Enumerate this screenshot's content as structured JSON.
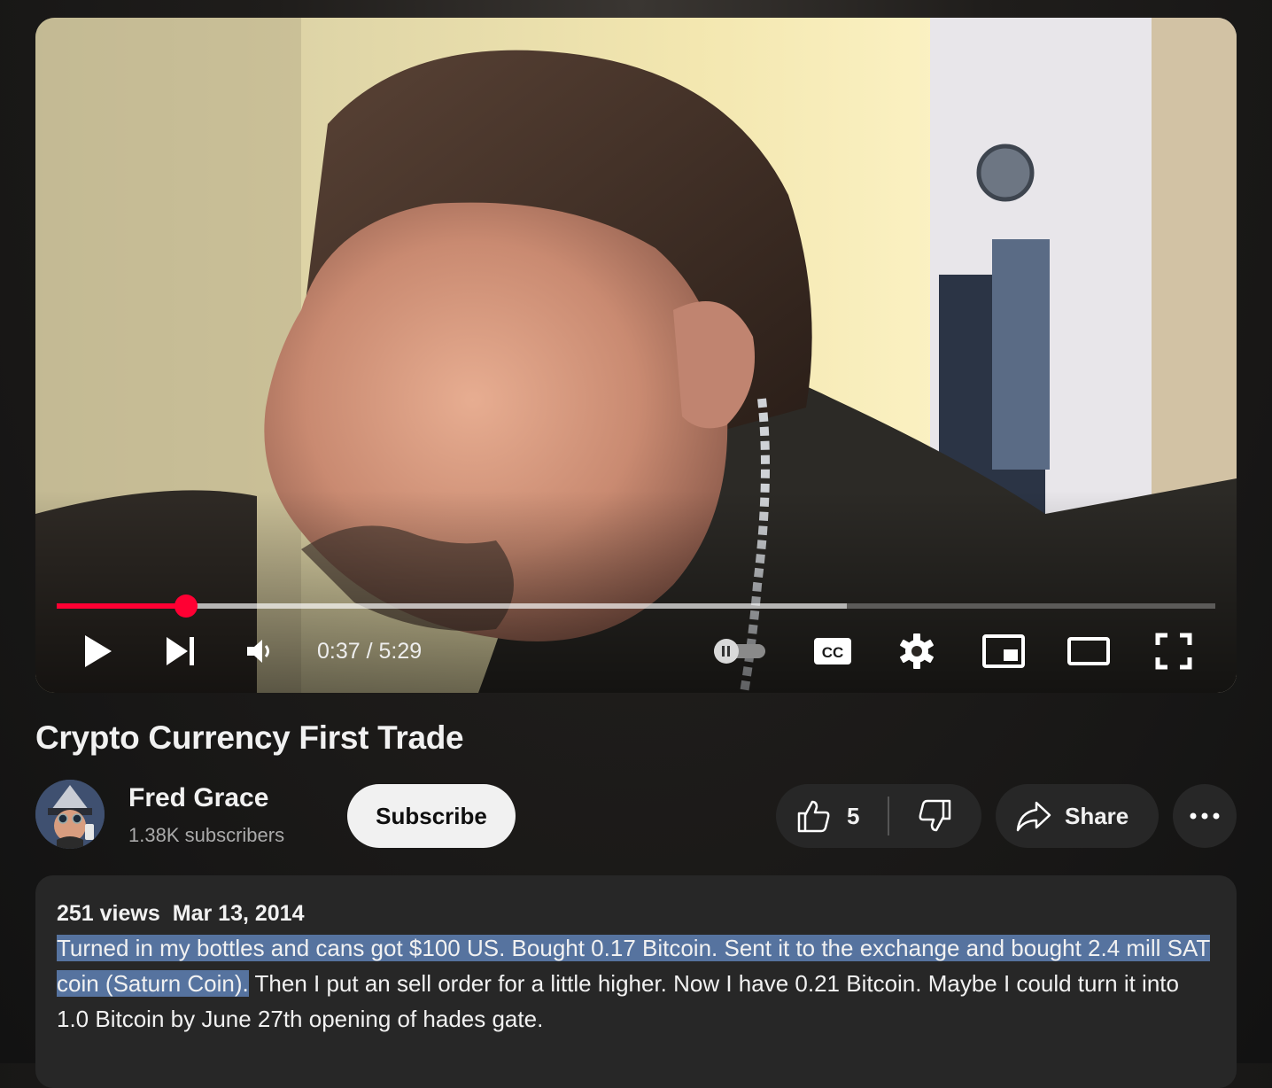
{
  "player": {
    "time_current": "0:37",
    "time_separator": " / ",
    "time_total": "5:29",
    "progress_played": 0.112,
    "progress_loaded": 0.682,
    "accent_color": "#ff0033",
    "controls": [
      "play-icon",
      "next-icon",
      "volume-icon",
      "autoplay-toggle-icon",
      "captions-icon",
      "settings-icon",
      "miniplayer-icon",
      "theater-mode-icon",
      "fullscreen-icon"
    ],
    "cc_label": "CC"
  },
  "video": {
    "title": "Crypto Currency First Trade"
  },
  "channel": {
    "name": "Fred Grace",
    "subscribers": "1.38K subscribers",
    "subscribe_label": "Subscribe"
  },
  "actions": {
    "like_count": "5",
    "share_label": "Share",
    "more_icon": "ellipsis-icon"
  },
  "description": {
    "views": "251 views",
    "date": "Mar 13, 2014",
    "text_highlighted": "Turned in my bottles and cans got $100 US. Bought 0.17 Bitcoin.  Sent it to the exchange and bought 2.4 mill SAT coin (Saturn Coin).",
    "text_rest": " Then I put an sell order for a little higher.  Now I have 0.21 Bitcoin.  Maybe I could turn it into 1.0 Bitcoin by June 27th opening of hades gate.",
    "highlight_color": "#56739f"
  }
}
